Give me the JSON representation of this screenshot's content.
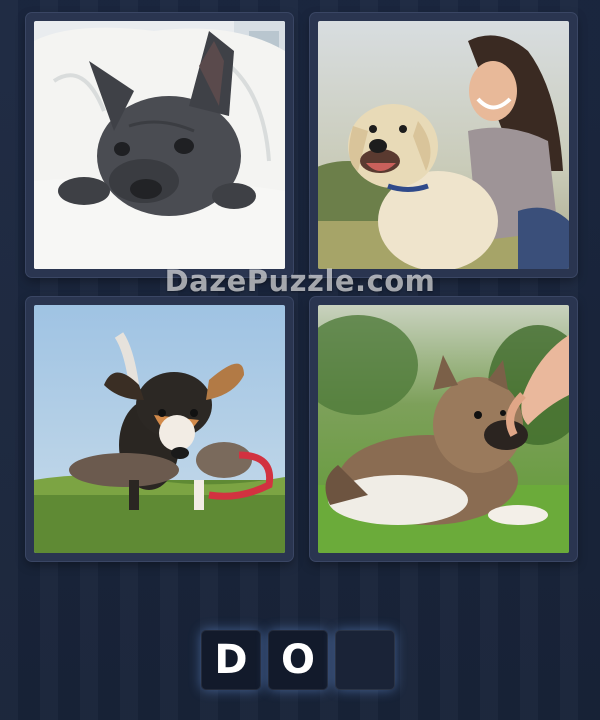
{
  "watermark": "DazePuzzle.com",
  "images": [
    {
      "subject": "gray french bulldog under blanket"
    },
    {
      "subject": "smiling woman hugging yellow labrador"
    },
    {
      "subject": "small terrier running with toy on grass"
    },
    {
      "subject": "fluffy puppy lying on grass sniffing hand"
    }
  ],
  "answer": {
    "letters": [
      "D",
      "O",
      ""
    ],
    "length": 3
  },
  "colors": {
    "background": "#1b2740",
    "tile_border": "#3a4664",
    "slot_bg": "#121a2b",
    "slot_glow": "#78aaff"
  }
}
